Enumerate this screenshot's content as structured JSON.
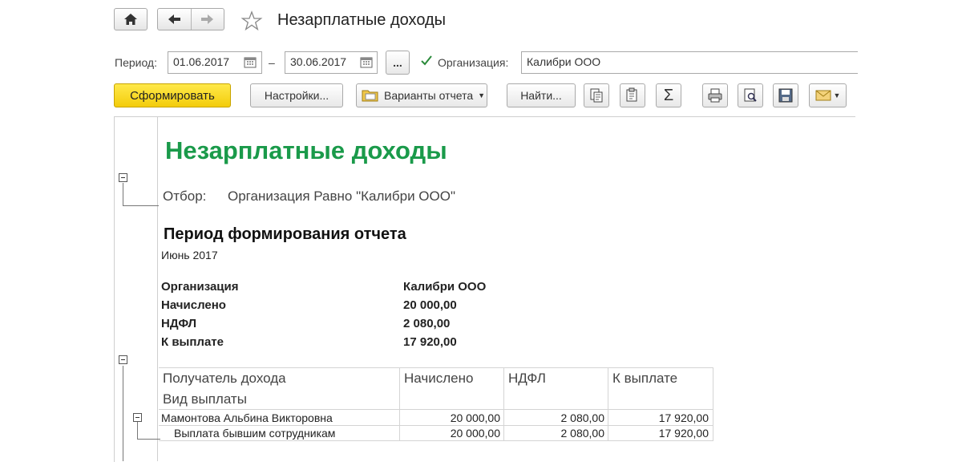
{
  "window": {
    "title": "Незарплатные доходы"
  },
  "params": {
    "period_label": "Период:",
    "date_from": "01.06.2017",
    "date_separator": "–",
    "date_to": "30.06.2017",
    "choose_period_label": "...",
    "org_checkbox_label": "Организация:",
    "org_checked": true,
    "org_value": "Калибри ООО"
  },
  "toolbar": {
    "generate_label": "Сформировать",
    "settings_label": "Настройки...",
    "variants_label": "Варианты отчета",
    "find_label": "Найти...",
    "sum_symbol": "Σ"
  },
  "report": {
    "title": "Незарплатные доходы",
    "filter_label": "Отбор:",
    "filter_value": "Организация Равно \"Калибри ООО\"",
    "period_heading": "Период формирования отчета",
    "period_value": "Июнь 2017",
    "summary": [
      {
        "label": "Организация",
        "value": "Калибри ООО"
      },
      {
        "label": "Начислено",
        "value": "20 000,00"
      },
      {
        "label": "НДФЛ",
        "value": "2 080,00"
      },
      {
        "label": "К выплате",
        "value": "17 920,00"
      }
    ],
    "table": {
      "headers": {
        "recipient": "Получатель дохода",
        "payment_type": "Вид выплаты",
        "accrued": "Начислено",
        "ndfl": "НДФЛ",
        "to_pay": "К выплате"
      },
      "rows": [
        {
          "name": "Мамонтова Альбина Викторовна",
          "accrued": "20 000,00",
          "ndfl": "2 080,00",
          "to_pay": "17 920,00"
        },
        {
          "name": "Выплата бывшим сотрудникам",
          "accrued": "20 000,00",
          "ndfl": "2 080,00",
          "to_pay": "17 920,00"
        }
      ]
    }
  },
  "colors": {
    "title_green": "#1a9a4a",
    "primary_yellow": "#f7d51d"
  }
}
